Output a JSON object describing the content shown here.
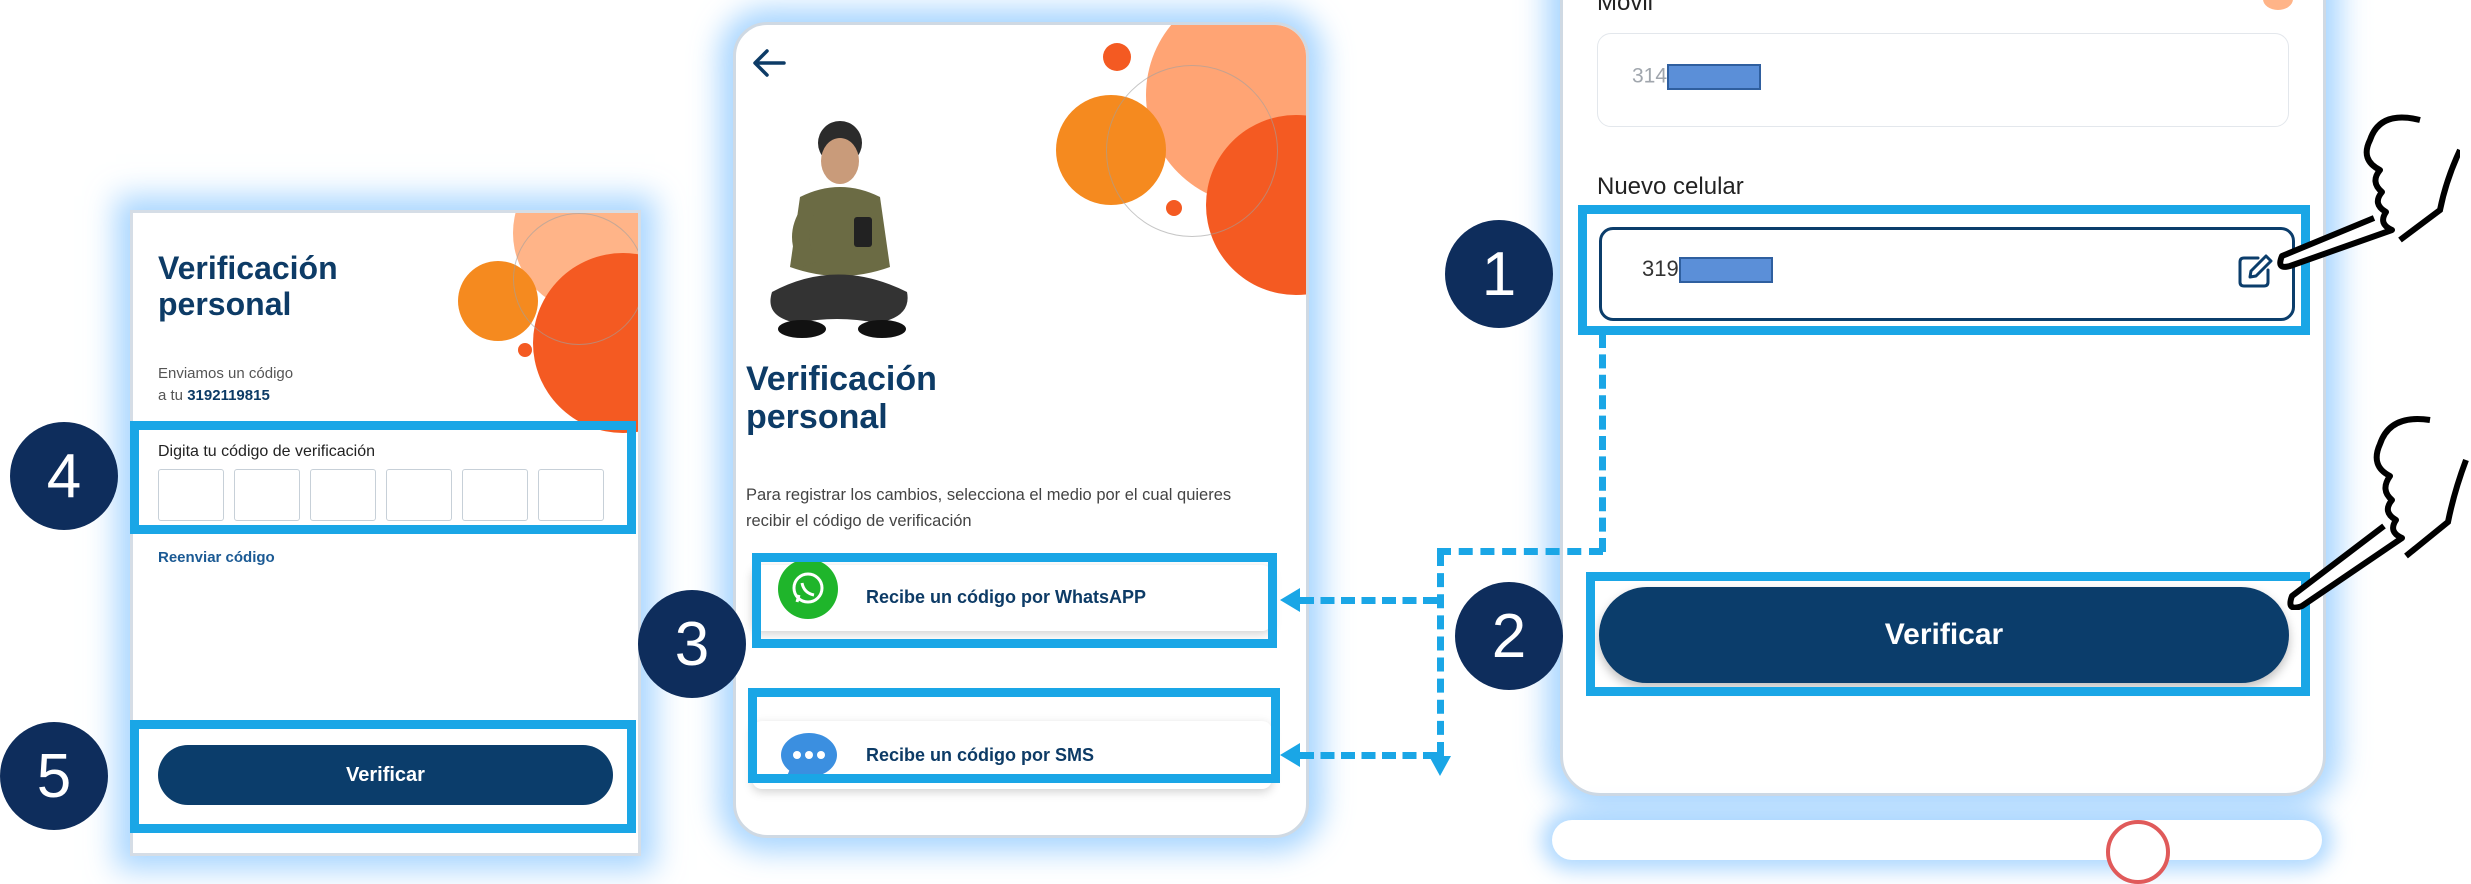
{
  "screen1": {
    "title": "Verificación personal",
    "sent_prefix": "Enviamos un código",
    "sent_to": "a tu",
    "phone": "3192119815",
    "code_label": "Digita tu código de verificación",
    "resend": "Reenviar código",
    "verify_button": "Verificar"
  },
  "screen2": {
    "title": "Verificación personal",
    "description": "Para registrar los cambios, selecciona el medio por el cual quieres recibir el código de verificación",
    "whatsapp_option": "Recibe un código por WhatsAPP",
    "sms_option": "Recibe un código por SMS"
  },
  "screen3": {
    "movil_label": "Movil",
    "current_phone_prefix": "314",
    "new_phone_label": "Nuevo celular",
    "new_phone_prefix": "319",
    "verify_button": "Verificar"
  },
  "steps": [
    "1",
    "2",
    "3",
    "4",
    "5"
  ],
  "colors": {
    "primary": "#0b3d6b",
    "highlight": "#1aa6e6",
    "step_badge": "#0e2d5c",
    "accent_orange": "#f45a22"
  }
}
